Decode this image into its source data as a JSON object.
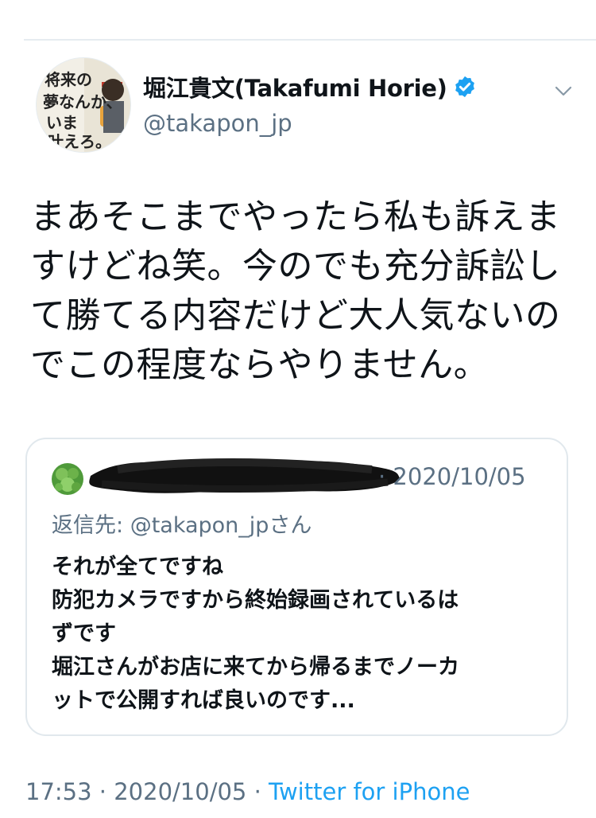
{
  "tweet": {
    "author": {
      "display_name": "堀江貴文(Takafumi Horie)",
      "handle": "@takapon_jp",
      "verified": true,
      "avatar_text": "将来の夢なんか、いま叶えろ。"
    },
    "text_lines": [
      "まあそこまでやったら私も訴えま",
      "すけどね笑。今のでも充分訴訟し",
      "て勝てる内容だけど大人気ないの",
      "でこの程度ならやりません。"
    ],
    "quoted": {
      "author_redacted": true,
      "date": "· 2020/10/05",
      "reply_prefix": "返信先: ",
      "reply_mention": "@takapon_jp",
      "reply_suffix": "さん",
      "text_lines": [
        "それが全てですね",
        "防犯カメラですから終始録画されているは",
        "ずです",
        "堀江さんがお店に来てから帰るまでノーカ",
        "ットで公開すれば良いのです..."
      ]
    },
    "footer": {
      "time": "17:53",
      "separator": " · ",
      "date": "2020/10/05",
      "source": "Twitter for iPhone"
    }
  },
  "icons": {
    "verified": "verified-badge-icon",
    "caret": "chevron-down-icon"
  },
  "colors": {
    "accent": "#1da1f2",
    "muted": "#5b7083",
    "text": "#0f1419",
    "border": "#e1e8ed"
  }
}
